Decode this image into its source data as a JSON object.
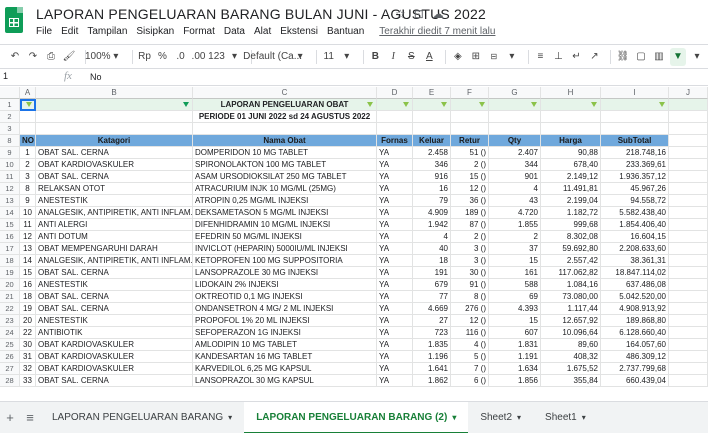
{
  "doc": {
    "title": "LAPORAN PENGELUARAN BARANG BULAN JUNI - AGUSTUS 2022"
  },
  "menu": [
    "File",
    "Edit",
    "Tampilan",
    "Sisipkan",
    "Format",
    "Data",
    "Alat",
    "Ekstensi",
    "Bantuan"
  ],
  "last_edit": "Terakhir diedit 7 menit lalu",
  "toolbar": {
    "zoom": "100%",
    "currency": "Rp",
    "percent": "%",
    "dec_less": ".0",
    "dec_more": ".00",
    "format": "123",
    "font": "Default (Ca...",
    "size": "11",
    "bold": "B",
    "italic": "I",
    "strike": "S",
    "color": "A"
  },
  "formula": {
    "namebox": "1",
    "fx": "fx",
    "value": "No"
  },
  "columns": [
    "",
    "A",
    "B",
    "C",
    "D",
    "E",
    "F",
    "G",
    "H",
    "I",
    "J"
  ],
  "report": {
    "title": "LAPORAN PENGELUARAN OBAT",
    "period": "PERIODE 01 JUNI 2022 sd 24 AGUSTUS 2022"
  },
  "headers": [
    "NO",
    "Katagori",
    "Nama Obat",
    "Fornas",
    "Keluar",
    "Retur",
    "Qty",
    "Harga",
    "SubTotal"
  ],
  "row_numbers": [
    "1",
    "2",
    "3",
    "8",
    "9",
    "10",
    "11",
    "12",
    "13",
    "14",
    "15",
    "16",
    "17",
    "18",
    "19",
    "20",
    "21",
    "22",
    "23",
    "24",
    "25",
    "26",
    "27",
    "28",
    "29",
    "30",
    "31",
    "32",
    "33"
  ],
  "rows": [
    [
      "1",
      "OBAT SAL. CERNA",
      "DOMPERIDON 10 MG TABLET",
      "YA",
      "2.458",
      "51 ()",
      "2.407",
      "90,88",
      "218.748,16"
    ],
    [
      "2",
      "OBAT KARDIOVASKULER",
      "SPIRONOLAKTON 100 MG TABLET",
      "YA",
      "346",
      "2 ()",
      "344",
      "678,40",
      "233.369,61"
    ],
    [
      "3",
      "OBAT SAL. CERNA",
      "ASAM URSODIOKSILAT 250 MG TABLET",
      "YA",
      "916",
      "15 ()",
      "901",
      "2.149,12",
      "1.936.357,12"
    ],
    [
      "8",
      "RELAKSAN OTOT",
      "ATRACURIUM INJK 10 MG/ML (25MG)",
      "YA",
      "16",
      "12 ()",
      "4",
      "11.491,81",
      "45.967,26"
    ],
    [
      "9",
      "ANESTESTIK",
      "ATROPIN 0,25 MG/ML INJEKSI",
      "YA",
      "79",
      "36 ()",
      "43",
      "2.199,04",
      "94.558,72"
    ],
    [
      "10",
      "ANALGESIK, ANTIPIRETIK, ANTI INFLAM...",
      "DEKSAMETASON 5 MG/ML INJEKSI",
      "YA",
      "4.909",
      "189 ()",
      "4.720",
      "1.182,72",
      "5.582.438,40"
    ],
    [
      "11",
      "ANTI ALERGI",
      "DIFENHIDRAMIN 10 MG/ML INJEKSI",
      "YA",
      "1.942",
      "87 ()",
      "1.855",
      "999,68",
      "1.854.406,40"
    ],
    [
      "12",
      "ANTI DOTUM",
      "EFEDRIN 50 MG/ML INJEKSI",
      "YA",
      "4",
      "2 ()",
      "2",
      "8.302,08",
      "16.604,15"
    ],
    [
      "13",
      "OBAT MEMPENGARUHI DARAH",
      "INVICLOT (HEPARIN) 5000IU/ML INJEKSI",
      "YA",
      "40",
      "3 ()",
      "37",
      "59.692,80",
      "2.208.633,60"
    ],
    [
      "14",
      "ANALGESIK, ANTIPIRETIK, ANTI INFLAM...",
      "KETOPROFEN 100 MG SUPPOSITORIA",
      "YA",
      "18",
      "3 ()",
      "15",
      "2.557,42",
      "38.361,31"
    ],
    [
      "15",
      "OBAT SAL. CERNA",
      "LANSOPRAZOLE 30 MG INJEKSI",
      "YA",
      "191",
      "30 ()",
      "161",
      "117.062,82",
      "18.847.114,02"
    ],
    [
      "16",
      "ANESTESTIK",
      "LIDOKAIN 2% INJEKSI",
      "YA",
      "679",
      "91 ()",
      "588",
      "1.084,16",
      "637.486,08"
    ],
    [
      "18",
      "OBAT SAL. CERNA",
      "OKTREOTID 0,1 MG INJEKSI",
      "YA",
      "77",
      "8 ()",
      "69",
      "73.080,00",
      "5.042.520,00"
    ],
    [
      "19",
      "OBAT SAL. CERNA",
      "ONDANSETRON 4 MG/ 2 ML INJEKSI",
      "YA",
      "4.669",
      "276 ()",
      "4.393",
      "1.117,44",
      "4.908.913,92"
    ],
    [
      "20",
      "ANESTESTIK",
      "PROPOFOL 1% 20 ML INJEKSI",
      "YA",
      "27",
      "12 ()",
      "15",
      "12.657,92",
      "189.868,80"
    ],
    [
      "22",
      "ANTIBIOTIK",
      "SEFOPERAZON 1G INJEKSI",
      "YA",
      "723",
      "116 ()",
      "607",
      "10.096,64",
      "6.128.660,40"
    ],
    [
      "30",
      "OBAT KARDIOVASKULER",
      "AMLODIPIN 10 MG TABLET",
      "YA",
      "1.835",
      "4 ()",
      "1.831",
      "89,60",
      "164.057,60"
    ],
    [
      "31",
      "OBAT KARDIOVASKULER",
      "KANDESARTAN 16 MG TABLET",
      "YA",
      "1.196",
      "5 ()",
      "1.191",
      "408,32",
      "486.309,12"
    ],
    [
      "32",
      "OBAT KARDIOVASKULER",
      "KARVEDILOL 6,25 MG KAPSUL",
      "YA",
      "1.641",
      "7 ()",
      "1.634",
      "1.675,52",
      "2.737.799,68"
    ],
    [
      "33",
      "OBAT SAL. CERNA",
      "LANSOPRAZOL 30 MG KAPSUL",
      "YA",
      "1.862",
      "6 ()",
      "1.856",
      "355,84",
      "660.439,04"
    ]
  ],
  "tabs": [
    "LAPORAN PENGELUARAN BARANG",
    "LAPORAN PENGELUARAN BARANG (2)",
    "Sheet2",
    "Sheet1"
  ],
  "active_tab": 1,
  "colors": {
    "header_blue": "#6fa8dc",
    "sheets_green": "#0f9d58",
    "active_tab": "#188038"
  }
}
